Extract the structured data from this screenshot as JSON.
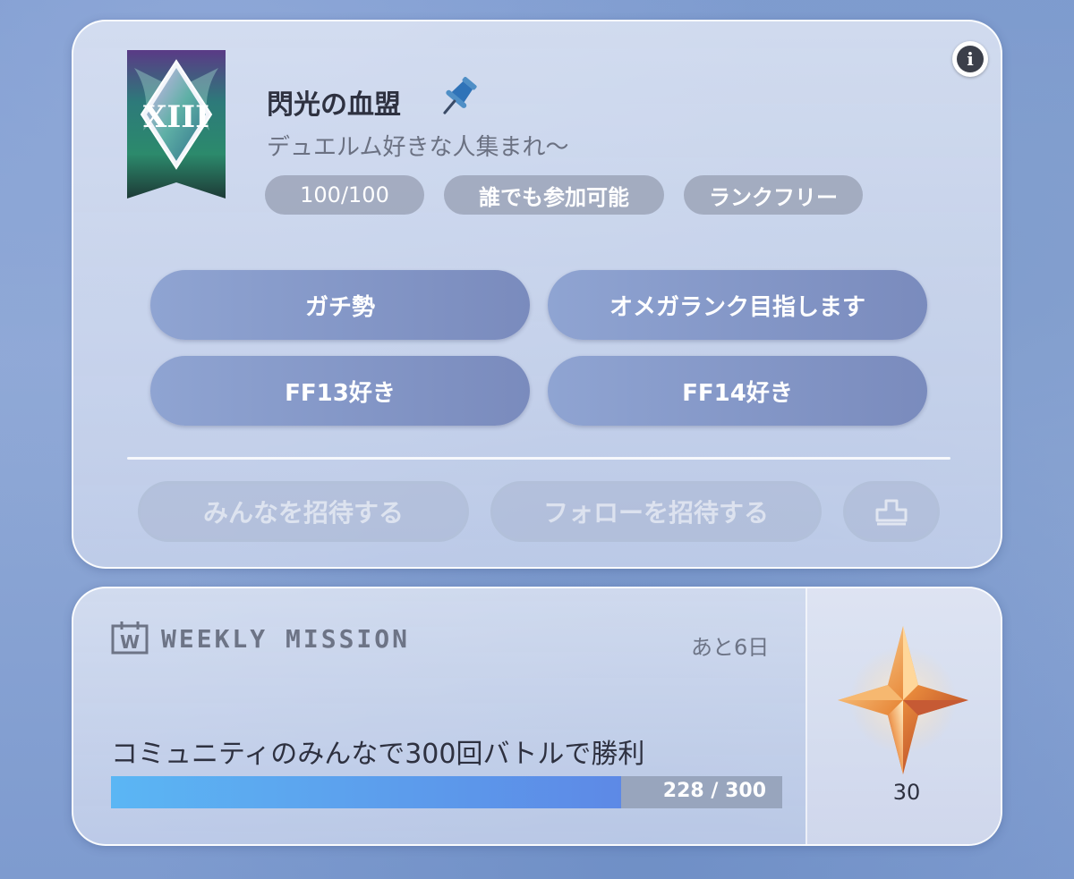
{
  "community": {
    "name": "閃光の血盟",
    "description": "デュエルム好きな人集まれ〜",
    "emblem_numeral": "XIII",
    "tags": {
      "members": "100/100",
      "join_policy": "誰でも参加可能",
      "rank": "ランクフリー"
    },
    "keywords": [
      "ガチ勢",
      "オメガランク目指します",
      "FF13好き",
      "FF14好き"
    ],
    "actions": {
      "invite_all": "みんなを招待する",
      "invite_follow": "フォローを招待する"
    },
    "icons": {
      "info": "info-icon",
      "pin": "pin-icon",
      "share": "share-icon",
      "emblem": "emblem-icon"
    }
  },
  "mission": {
    "label": "WEEKLY MISSION",
    "icon_letter": "W",
    "time_left": "あと6日",
    "description": "コミュニティのみんなで300回バトルで勝利",
    "progress_current": 228,
    "progress_total": 300,
    "progress_text": "228 / 300",
    "reward_count": "30",
    "reward_icon": "crystal-star-icon"
  },
  "colors": {
    "accent_blue": "#5d89e6",
    "progress_start": "#5bb6f4",
    "pill": "#8192c4"
  }
}
